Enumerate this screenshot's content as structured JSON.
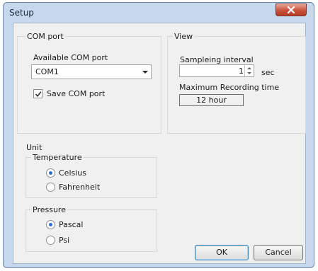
{
  "window": {
    "title": "Setup",
    "close_icon": "close-icon"
  },
  "com_port": {
    "group_label": "COM port",
    "available_label": "Available COM port",
    "selected": "COM1",
    "save_label": "Save COM port",
    "save_checked": true
  },
  "view": {
    "group_label": "View",
    "interval_label": "Sampleing interval",
    "interval_value": "1",
    "interval_unit": "sec",
    "max_label": "Maximum Recording time",
    "max_value": "12 hour"
  },
  "unit": {
    "group_label": "Unit",
    "temperature": {
      "label": "Temperature",
      "options": [
        "Celsius",
        "Fahrenheit"
      ],
      "selected": "Celsius"
    },
    "pressure": {
      "label": "Pressure",
      "options": [
        "Pascal",
        "Psi"
      ],
      "selected": "Pascal"
    }
  },
  "buttons": {
    "ok": "OK",
    "cancel": "Cancel"
  },
  "colors": {
    "close_button": "#c8513c",
    "radio_selected": "#2e6bd6",
    "frame": "#c5d8ec"
  }
}
